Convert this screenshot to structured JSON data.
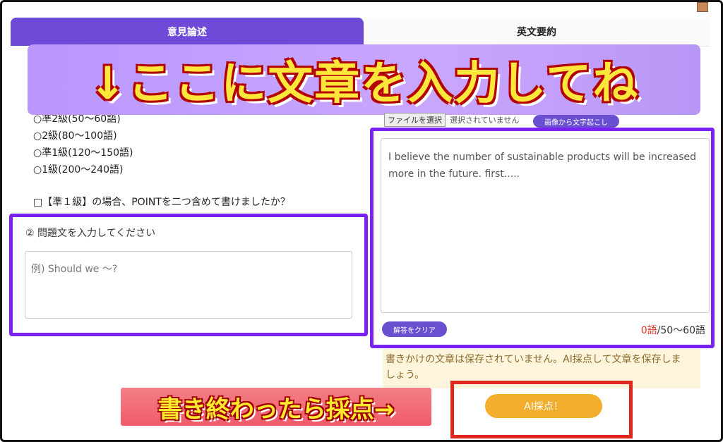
{
  "tabs": [
    {
      "label": "意見論述",
      "active": true
    },
    {
      "label": "英文要約",
      "active": false
    }
  ],
  "banner": {
    "text": "↓ここに文章を入力してね"
  },
  "levels": [
    "○準2級(50〜60語)",
    "○2級(80〜100語)",
    "○準1級(120〜150語)",
    "○1級(200〜240語)"
  ],
  "pre_check": {
    "text": "□【準１級】の場合、POINTを二つ含めて書けましたか？"
  },
  "question": {
    "label": "② 問題文を入力してください",
    "placeholder": "例) Should we 〜?"
  },
  "file_upload": {
    "button_label": "ファイルを選択",
    "status": "選択されていません",
    "ocr_button": "画像から文字起こし"
  },
  "answer": {
    "text": "I believe the number of sustainable products will be increased more in the future. first.....",
    "clear_button": "解答をクリア",
    "word_count_current": "0語",
    "word_count_target": "/50〜60語"
  },
  "notice": {
    "text": "書きかけの文章は保存されていません。AI採点して文章を保存しましょう。"
  },
  "bottom_label": {
    "text": "書き終わったら採点→"
  },
  "ai_button": {
    "label": "AI採点！"
  },
  "colors": {
    "tab_active": "#6f49d8",
    "highlight_purple": "#7a22f2",
    "highlight_red": "#e0281f",
    "ai_button": "#f2ae2c",
    "count_red": "#e53020"
  }
}
